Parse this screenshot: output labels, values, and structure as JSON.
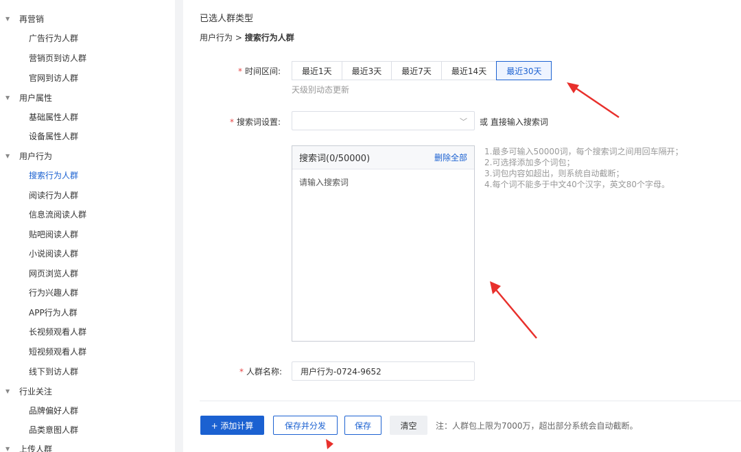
{
  "sidebar": {
    "groups": [
      {
        "label": "再营销",
        "items": [
          "广告行为人群",
          "营销页到访人群",
          "官网到访人群"
        ]
      },
      {
        "label": "用户属性",
        "items": [
          "基础属性人群",
          "设备属性人群"
        ]
      },
      {
        "label": "用户行为",
        "items": [
          "搜索行为人群",
          "阅读行为人群",
          "信息流阅读人群",
          "贴吧阅读人群",
          "小说阅读人群",
          "网页浏览人群",
          "行为兴趣人群",
          "APP行为人群",
          "长视频观看人群",
          "短视频观看人群",
          "线下到访人群"
        ]
      },
      {
        "label": "行业关注",
        "items": [
          "品牌偏好人群",
          "品类意图人群"
        ]
      },
      {
        "label": "上传人群",
        "items": []
      }
    ],
    "active_item": "搜索行为人群"
  },
  "header": {
    "section_title": "已选人群类型",
    "breadcrumb_parent": "用户行为 > ",
    "breadcrumb_current": "搜索行为人群"
  },
  "time_range": {
    "required": "*",
    "label": "时间区间:",
    "options": [
      "最近1天",
      "最近3天",
      "最近7天",
      "最近14天",
      "最近30天"
    ],
    "selected": "最近30天",
    "hint": "天级别动态更新"
  },
  "search_words": {
    "required": "*",
    "label": "搜索词设置:",
    "select_value": "",
    "alt_text": "或 直接输入搜索词",
    "box_title": "搜索词(0/50000)",
    "delete_all": "删除全部",
    "placeholder": "请输入搜索词",
    "hints": [
      "1.最多可输入50000词，每个搜索词之间用回车隔开；",
      "2.可选择添加多个词包；",
      "3.词包内容如超出，则系统自动截断；",
      "4.每个词不能多于中文40个汉字，英文80个字母。"
    ]
  },
  "crowd_name": {
    "required": "*",
    "label": "人群名称:",
    "value": "用户行为-0724-9652"
  },
  "footer": {
    "add_calc": "+ 添加计算",
    "save_distribute": "保存并分发",
    "save": "保存",
    "clear": "清空",
    "note": "注：人群包上限为7000万，超出部分系统会自动截断。"
  },
  "colors": {
    "accent": "#1b61d1",
    "required": "#e64545",
    "annotation_arrow": "#e8302c"
  }
}
